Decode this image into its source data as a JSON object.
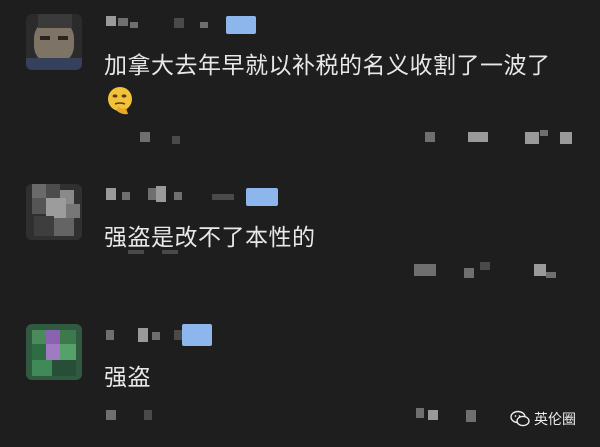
{
  "comments": [
    {
      "text": "加拿大去年早就以补税的名义收割了一波了",
      "has_emoji": true,
      "emoji": "thinking-face-emoji"
    },
    {
      "text": "强盗是改不了本性的"
    },
    {
      "text": "强盗"
    }
  ],
  "watermark": {
    "label": "英伦圈",
    "icon": "wechat-icon"
  },
  "colors": {
    "background": "#1e1e1e",
    "text": "#e8e8e8",
    "badge": "#5a8fd6"
  }
}
